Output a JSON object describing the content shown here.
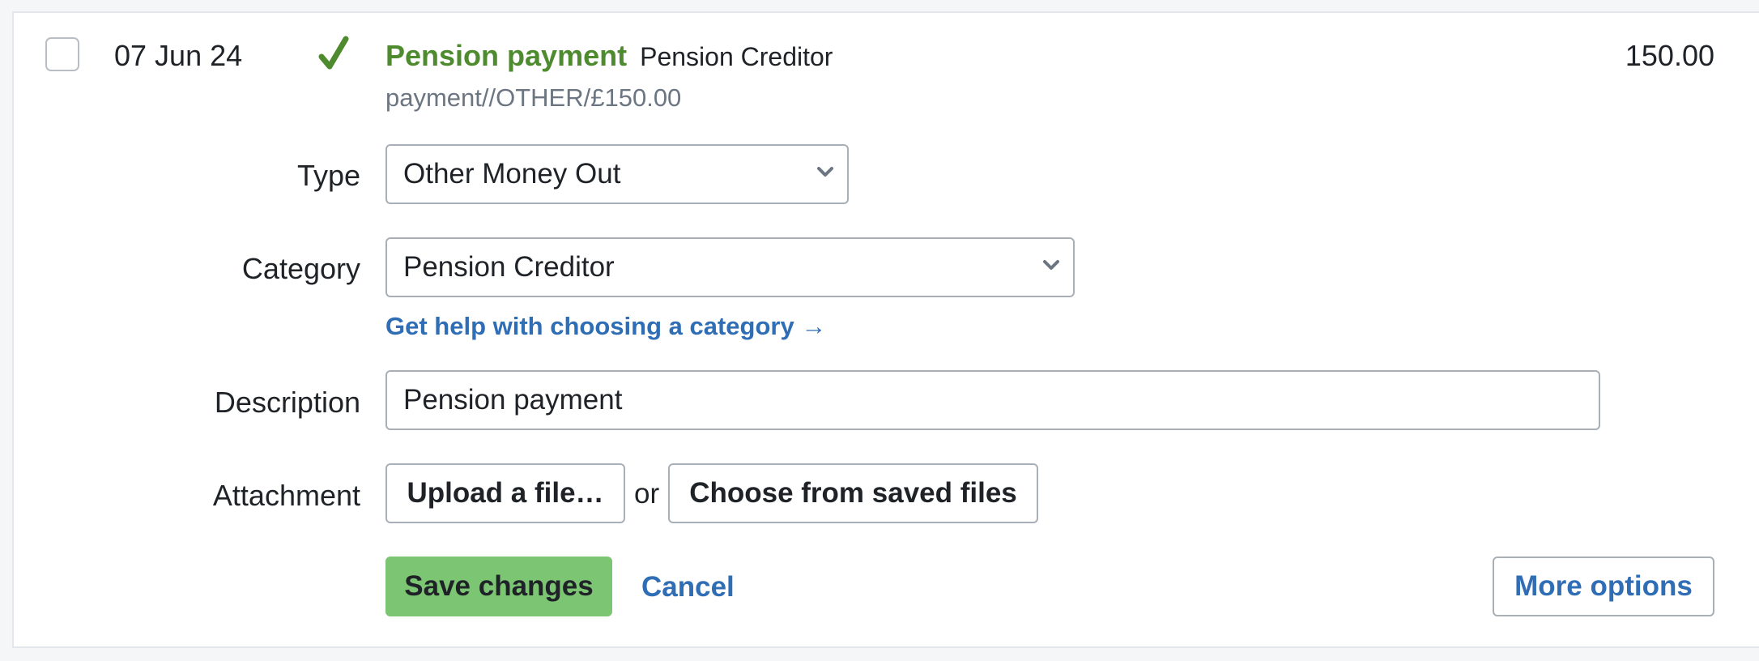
{
  "transaction": {
    "date": "07 Jun 24",
    "name": "Pension payment",
    "counterparty": "Pension Creditor",
    "reference": "payment//OTHER/£150.00",
    "amount": "150.00"
  },
  "form": {
    "type_label": "Type",
    "type_value": "Other Money Out",
    "category_label": "Category",
    "category_value": "Pension Creditor",
    "help_link": "Get help with choosing a category →",
    "description_label": "Description",
    "description_value": "Pension payment",
    "attachment_label": "Attachment",
    "upload_label": "Upload a file…",
    "or_text": "or",
    "choose_saved_label": "Choose from saved files"
  },
  "actions": {
    "save_label": "Save changes",
    "cancel_label": "Cancel",
    "more_label": "More options"
  },
  "icons": {
    "status": "checkmark-icon",
    "dropdown": "chevron-down-icon"
  },
  "colors": {
    "accent_green": "#4e8a2e",
    "save_button": "#7cc673",
    "link_blue": "#2f6db5"
  }
}
